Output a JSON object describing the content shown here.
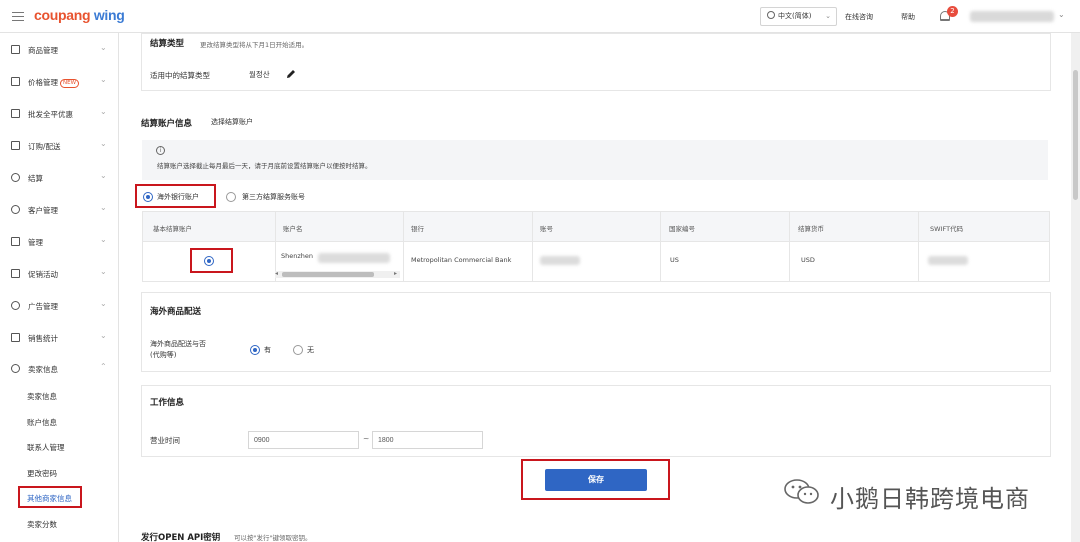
{
  "header": {
    "logo_part1": "coupang",
    "logo_part2": "wing",
    "language": "中文(简体)",
    "online_consult": "在线咨询",
    "help": "帮助",
    "notification_count": "2"
  },
  "sidebar": {
    "items": [
      {
        "label": "商品管理",
        "icon": "box-icon"
      },
      {
        "label": "价格管理",
        "icon": "price-tag-icon",
        "tag": "NEW"
      },
      {
        "label": "批发全平优惠",
        "icon": "discount-icon"
      },
      {
        "label": "订购/配送",
        "icon": "truck-icon"
      },
      {
        "label": "结算",
        "icon": "coin-icon"
      },
      {
        "label": "客户管理",
        "icon": "smile-icon"
      },
      {
        "label": "管理",
        "icon": "folder-icon"
      },
      {
        "label": "促销活动",
        "icon": "promo-icon"
      },
      {
        "label": "广告管理",
        "icon": "ad-icon"
      },
      {
        "label": "销售统计",
        "icon": "stats-icon"
      },
      {
        "label": "卖家信息",
        "icon": "user-icon"
      }
    ],
    "sub_items": [
      {
        "label": "卖家信息"
      },
      {
        "label": "账户信息"
      },
      {
        "label": "联系人管理"
      },
      {
        "label": "更改密码"
      },
      {
        "label": "其他商家信息",
        "active": true
      },
      {
        "label": "卖家分数"
      }
    ]
  },
  "settlement_type": {
    "title": "结算类型",
    "note": "更改结算类型将从下月1日开始适用。",
    "label": "适用中的结算类型",
    "value": "월정산"
  },
  "settlement_account": {
    "title": "结算账户信息",
    "subtitle": "选择结算账户",
    "info_icon": "i",
    "info_text": "结算账户选择截止每月最后一天，请于月底前设置结算账户以便按时结算。",
    "options": [
      "海外银行账户",
      "第三方结算服务账号"
    ],
    "selected": "海外银行账户",
    "columns": [
      "基本结算账户",
      "账户名",
      "银行",
      "账号",
      "国家编号",
      "结算货币",
      "SWIFT代码"
    ],
    "rows": [
      {
        "account_name": "Shenzhen",
        "bank": "Metropolitan Commercial Bank",
        "country": "US",
        "currency": "USD"
      }
    ]
  },
  "overseas": {
    "title": "海外商品配送",
    "label_line1": "海外商品配送与否",
    "label_line2": "(代购等)",
    "yes": "有",
    "no": "无",
    "selected": "有"
  },
  "work": {
    "title": "工作信息",
    "label": "营业时间",
    "start": "0900",
    "separator": "~",
    "end": "1800"
  },
  "save_label": "保存",
  "open_api": {
    "title": "发行OPEN API密钥",
    "note": "可以按\"发行\"键领取密钥。"
  },
  "watermark": {
    "text": "小鹅日韩跨境电商",
    "icon": "wechat-icon"
  },
  "colors": {
    "accent": "#2f66c4",
    "highlight_box": "#c9161d",
    "logo_orange": "#e8532f",
    "logo_blue": "#3b7bd4"
  }
}
